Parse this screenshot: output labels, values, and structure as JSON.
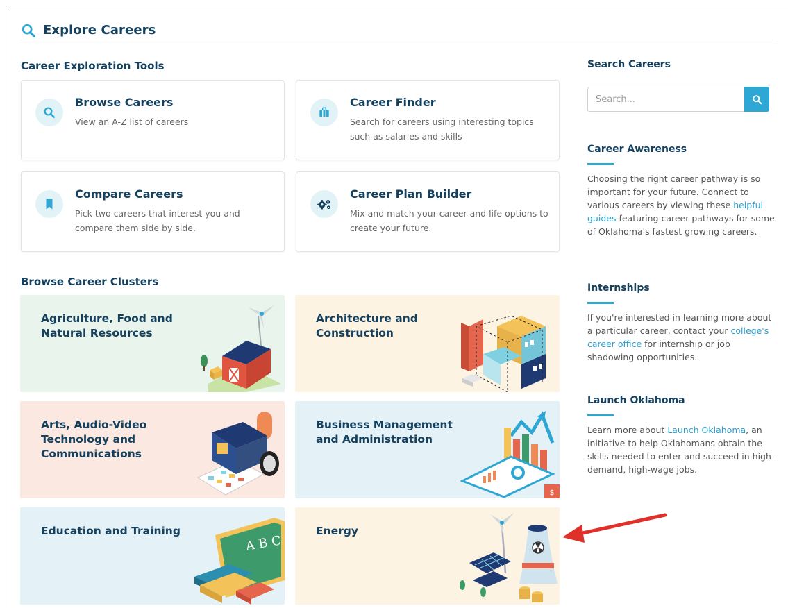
{
  "header": {
    "title": "Explore Careers"
  },
  "tools_section": {
    "title": "Career Exploration Tools"
  },
  "tools": [
    {
      "title": "Browse Careers",
      "desc": "View an A-Z list of careers"
    },
    {
      "title": "Career Finder",
      "desc": "Search for careers using interesting topics such as salaries and skills"
    },
    {
      "title": "Compare Careers",
      "desc": "Pick two careers that interest you and compare them side by side."
    },
    {
      "title": "Career Plan Builder",
      "desc": "Mix and match your career and life options to create your future."
    }
  ],
  "clusters_section": {
    "title": "Browse Career Clusters"
  },
  "clusters": [
    {
      "title": "Agriculture, Food and Natural Resources",
      "bg": "#e8f4ec"
    },
    {
      "title": "Architecture and Construction",
      "bg": "#fdf3e3"
    },
    {
      "title": "Arts, Audio-Video Technology and Communications",
      "bg": "#fae8e1"
    },
    {
      "title": "Business Management and Administration",
      "bg": "#e4f2f8"
    },
    {
      "title": "Education and Training",
      "bg": "#e4f2f8"
    },
    {
      "title": "Energy",
      "bg": "#fdf3e3"
    }
  ],
  "sidebar": {
    "search": {
      "title": "Search Careers",
      "placeholder": "Search..."
    },
    "awareness": {
      "title": "Career Awareness",
      "text_before": "Choosing the right career pathway is so important for your future. Connect to various careers by viewing these ",
      "link": "helpful guides",
      "text_after": " featuring career pathways for some of Oklahoma's fastest growing careers."
    },
    "internships": {
      "title": "Internships",
      "text_before": "If you're interested in learning more about a particular career, contact your ",
      "link": "college's career office",
      "text_after": " for internship or job shadowing opportunities."
    },
    "launch": {
      "title": "Launch Oklahoma",
      "text_before": "Learn more about ",
      "link": "Launch Oklahoma",
      "text_after": ", an initiative to help Oklahomans obtain the skills needed to enter and succeed in high-demand, high-wage jobs."
    }
  },
  "colors": {
    "accent": "#2fa7d4",
    "heading": "#15405e",
    "arrow": "#e0302a"
  }
}
